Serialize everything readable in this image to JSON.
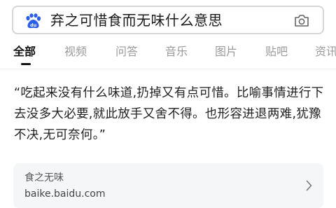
{
  "search": {
    "query": "弃之可惜食而无味什么意思",
    "logo_icon": "baidu-paw-icon",
    "camera_icon": "camera-icon"
  },
  "tabs": [
    {
      "label": "全部",
      "active": true
    },
    {
      "label": "视频",
      "active": false
    },
    {
      "label": "问答",
      "active": false
    },
    {
      "label": "音乐",
      "active": false
    },
    {
      "label": "图片",
      "active": false
    },
    {
      "label": "贴吧",
      "active": false
    },
    {
      "label": "资讯",
      "active": false
    }
  ],
  "answer": {
    "text": "“吃起来没有什么味道,扔掉又有点可惜。比喻事情进行下去没多大必要,就此放手又舍不得。也形容进退两难,犹豫不决,无可奈何。”"
  },
  "source": {
    "title": "食之无味",
    "url": "baike.baidu.com",
    "chevron_icon": "chevron-right-icon"
  },
  "colors": {
    "logo_blue": "#2b5ee8",
    "active_tab": "#111111",
    "inactive_tab": "#9a9a9a",
    "card_bg": "#f5f6f8"
  }
}
